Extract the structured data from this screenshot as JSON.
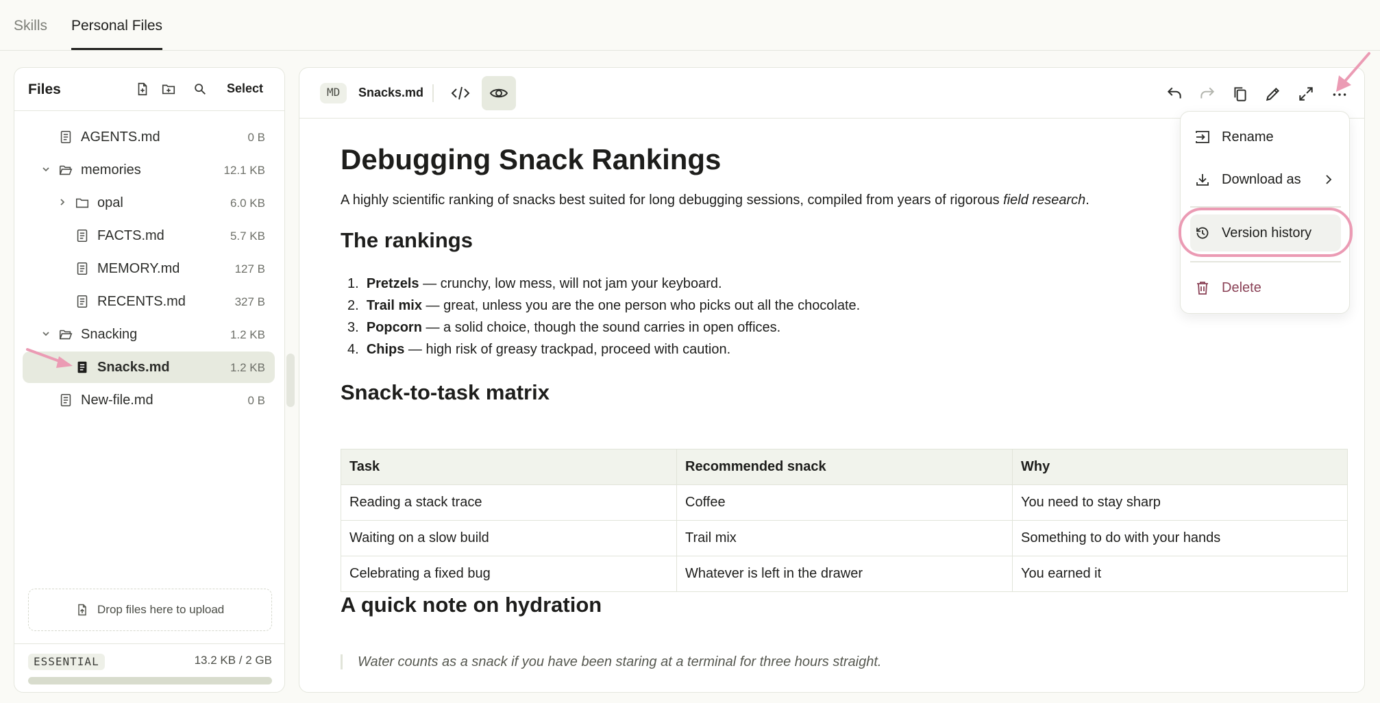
{
  "tabs": {
    "skills": "Skills",
    "personal_files": "Personal Files"
  },
  "sidebar": {
    "title": "Files",
    "select_label": "Select",
    "items": [
      {
        "name": "AGENTS.md",
        "size": "0 B",
        "type": "file",
        "icon": "file-icon"
      },
      {
        "name": "memories",
        "size": "12.1 KB",
        "type": "folder",
        "icon": "folder-open-icon",
        "expanded": true
      },
      {
        "name": "opal",
        "size": "6.0 KB",
        "type": "folder",
        "icon": "folder-icon",
        "expanded": false
      },
      {
        "name": "FACTS.md",
        "size": "5.7 KB",
        "type": "file",
        "icon": "file-icon"
      },
      {
        "name": "MEMORY.md",
        "size": "127 B",
        "type": "file",
        "icon": "file-icon"
      },
      {
        "name": "RECENTS.md",
        "size": "327 B",
        "type": "file",
        "icon": "file-icon"
      },
      {
        "name": "Snacking",
        "size": "1.2 KB",
        "type": "folder",
        "icon": "folder-open-icon",
        "expanded": true
      },
      {
        "name": "Snacks.md",
        "size": "1.2 KB",
        "type": "file",
        "icon": "file-filled-icon",
        "selected": true
      },
      {
        "name": "New-file.md",
        "size": "0 B",
        "type": "file",
        "icon": "file-icon"
      }
    ],
    "dropzone_text": "Drop files here to upload",
    "plan": "ESSENTIAL",
    "usage": "13.2 KB / 2 GB",
    "usage_fraction": 0.0
  },
  "editor": {
    "type_badge": "MD",
    "filename": "Snacks.md",
    "doc": {
      "title": "Debugging Snack Rankings",
      "intro": "A highly scientific ranking of snacks best suited for long debugging sessions, compiled from years of rigorous ",
      "intro_em": "field research",
      "intro_end": ".",
      "h_rankings": "The rankings",
      "rankings": [
        {
          "num": "1.",
          "name": "Pretzels",
          "desc": " — crunchy, low mess, will not jam your keyboard."
        },
        {
          "num": "2.",
          "name": "Trail mix",
          "desc": " — great, unless you are the one person who picks out all the chocolate."
        },
        {
          "num": "3.",
          "name": "Popcorn",
          "desc": " — a solid choice, though the sound carries in open offices."
        },
        {
          "num": "4.",
          "name": "Chips",
          "desc": " — high risk of greasy trackpad, proceed with caution."
        }
      ],
      "h_matrix": "Snack-to-task matrix",
      "table": {
        "headers": [
          "Task",
          "Recommended snack",
          "Why"
        ],
        "rows": [
          [
            "Reading a stack trace",
            "Coffee",
            "You need to stay sharp"
          ],
          [
            "Waiting on a slow build",
            "Trail mix",
            "Something to do with your hands"
          ],
          [
            "Celebrating a fixed bug",
            "Whatever is left in the drawer",
            "You earned it"
          ]
        ]
      },
      "h_hydration": "A quick note on hydration",
      "quote": "Water counts as a snack if you have been staring at a terminal for three hours straight."
    }
  },
  "menu": {
    "rename": "Rename",
    "download_as": "Download as",
    "version_history": "Version history",
    "delete": "Delete"
  },
  "colors": {
    "accent_pink": "#eb9bb4",
    "danger": "#8a4156",
    "selected_bg": "#e7eadf"
  }
}
